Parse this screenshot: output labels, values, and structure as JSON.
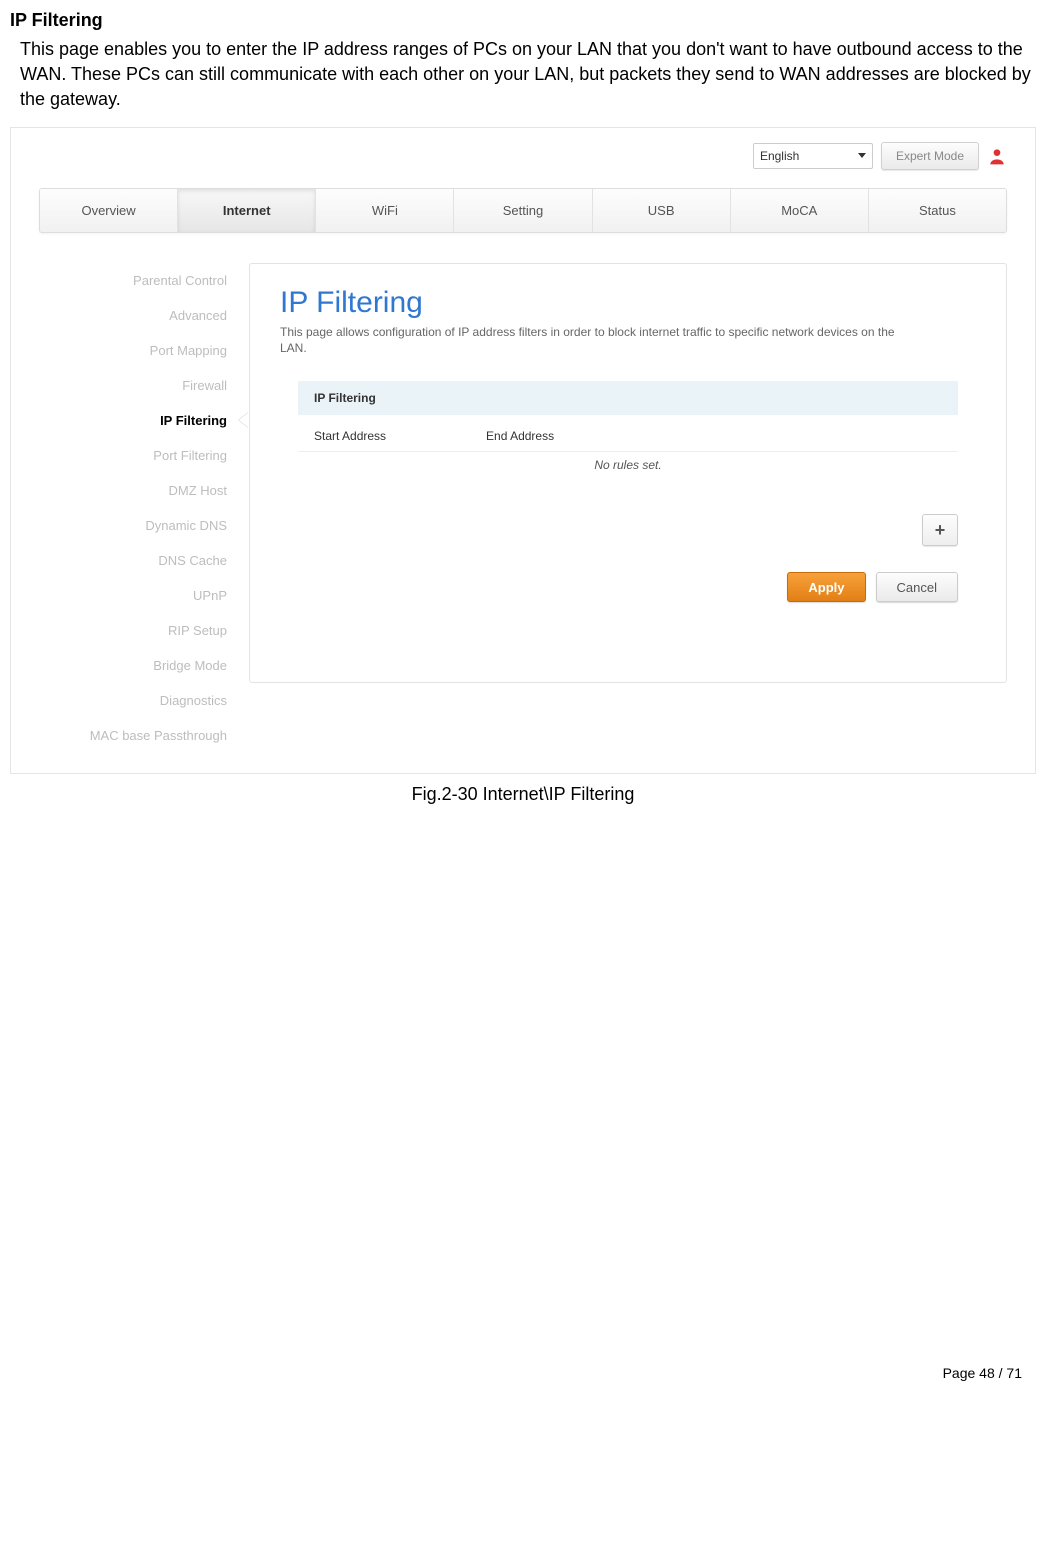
{
  "doc": {
    "section_title": "IP Filtering",
    "section_desc": "This page enables you to enter the IP address ranges of PCs on your LAN that you don't want to have outbound access to the WAN. These PCs can still communicate with each other on your LAN, but packets they send to WAN addresses are blocked by the gateway.",
    "fig_caption": "Fig.2-30 Internet\\IP Filtering",
    "footer": "Page 48 / 71"
  },
  "topbar": {
    "language": "English",
    "expert_mode": "Expert Mode"
  },
  "nav": {
    "items": [
      "Overview",
      "Internet",
      "WiFi",
      "Setting",
      "USB",
      "MoCA",
      "Status"
    ],
    "active_index": 1
  },
  "sidebar": {
    "items": [
      "Parental Control",
      "Advanced",
      "Port Mapping",
      "Firewall",
      "IP Filtering",
      "Port Filtering",
      "DMZ Host",
      "Dynamic DNS",
      "DNS Cache",
      "UPnP",
      "RIP Setup",
      "Bridge Mode",
      "Diagnostics",
      "MAC base Passthrough"
    ],
    "active_index": 4
  },
  "panel": {
    "title": "IP Filtering",
    "desc": "This page allows configuration of IP address filters in order to block internet traffic to specific network devices on the LAN.",
    "table_title": "IP Filtering",
    "col_start": "Start Address",
    "col_end": "End Address",
    "no_rules": "No rules set.",
    "plus": "+",
    "apply": "Apply",
    "cancel": "Cancel"
  }
}
